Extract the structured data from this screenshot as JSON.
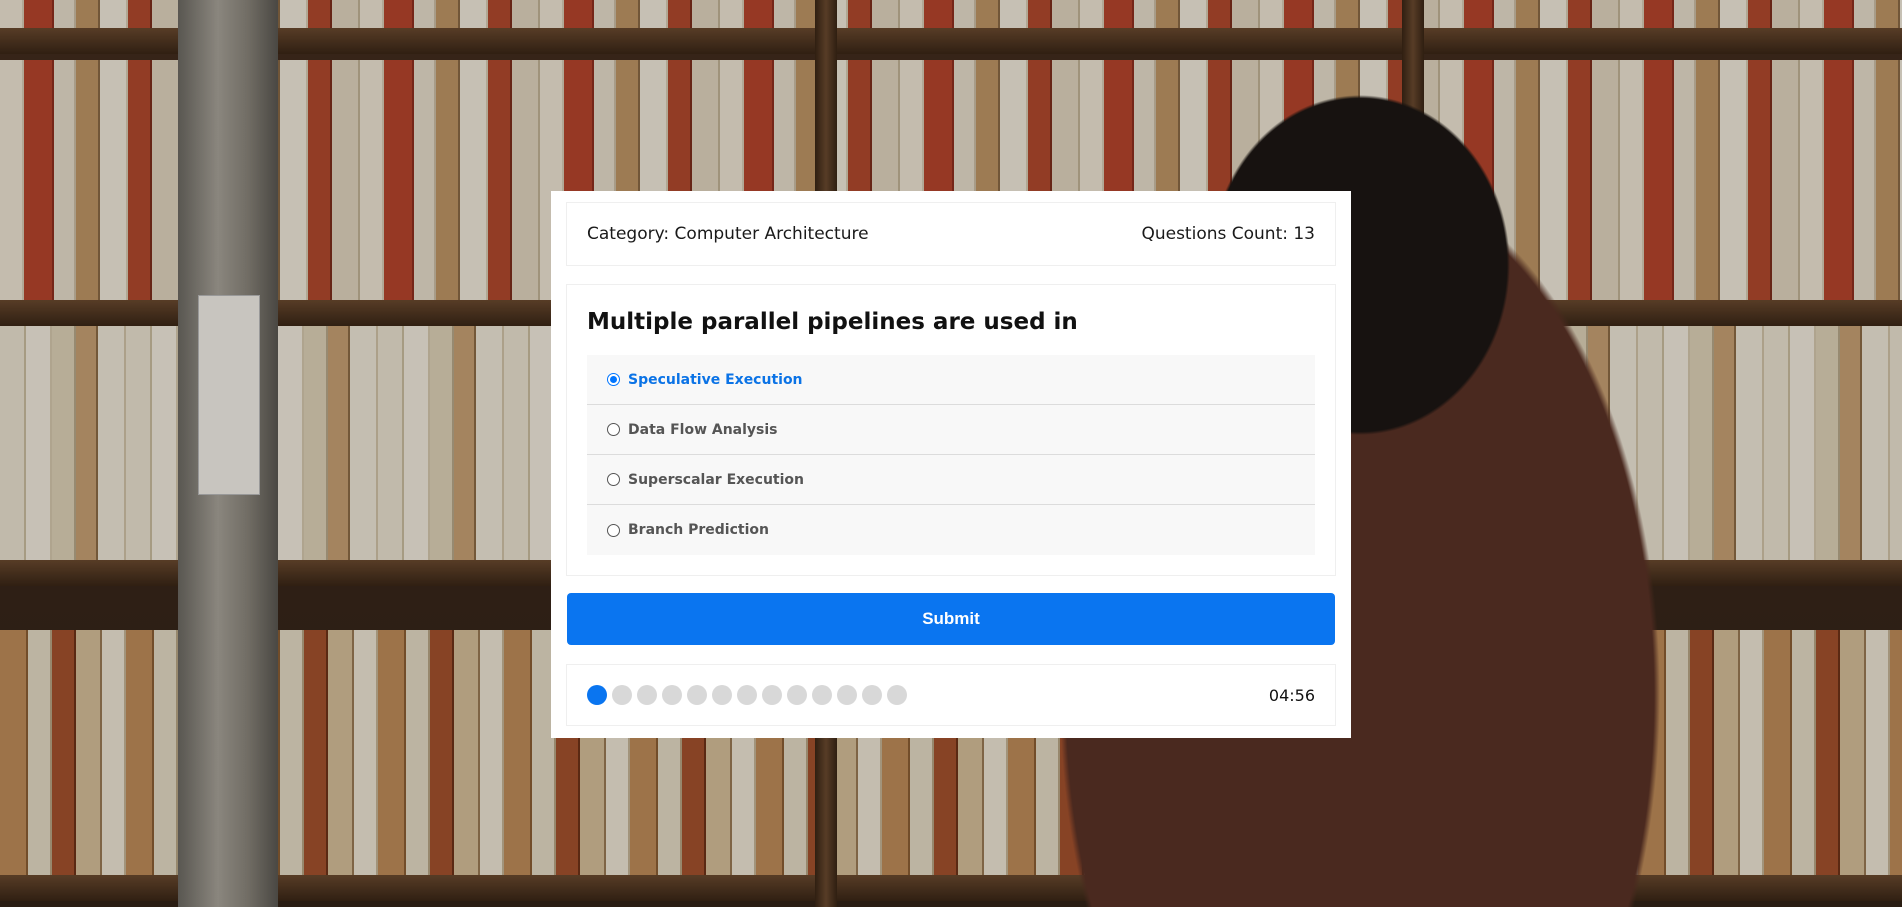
{
  "header": {
    "category": "Category: Computer Architecture",
    "questions_count": "Questions Count: 13"
  },
  "question": {
    "text": "Multiple parallel pipelines are used in",
    "options": [
      {
        "label": "Speculative Execution",
        "selected": true
      },
      {
        "label": "Data Flow Analysis",
        "selected": false
      },
      {
        "label": "Superscalar Execution",
        "selected": false
      },
      {
        "label": "Branch Prediction",
        "selected": false
      }
    ]
  },
  "submit_label": "Submit",
  "progress": {
    "total": 13,
    "current": 1
  },
  "timer": "04:56",
  "colors": {
    "accent": "#0a75f0",
    "selected_text": "#0b73e6",
    "dot_inactive": "#d8d8d8"
  }
}
